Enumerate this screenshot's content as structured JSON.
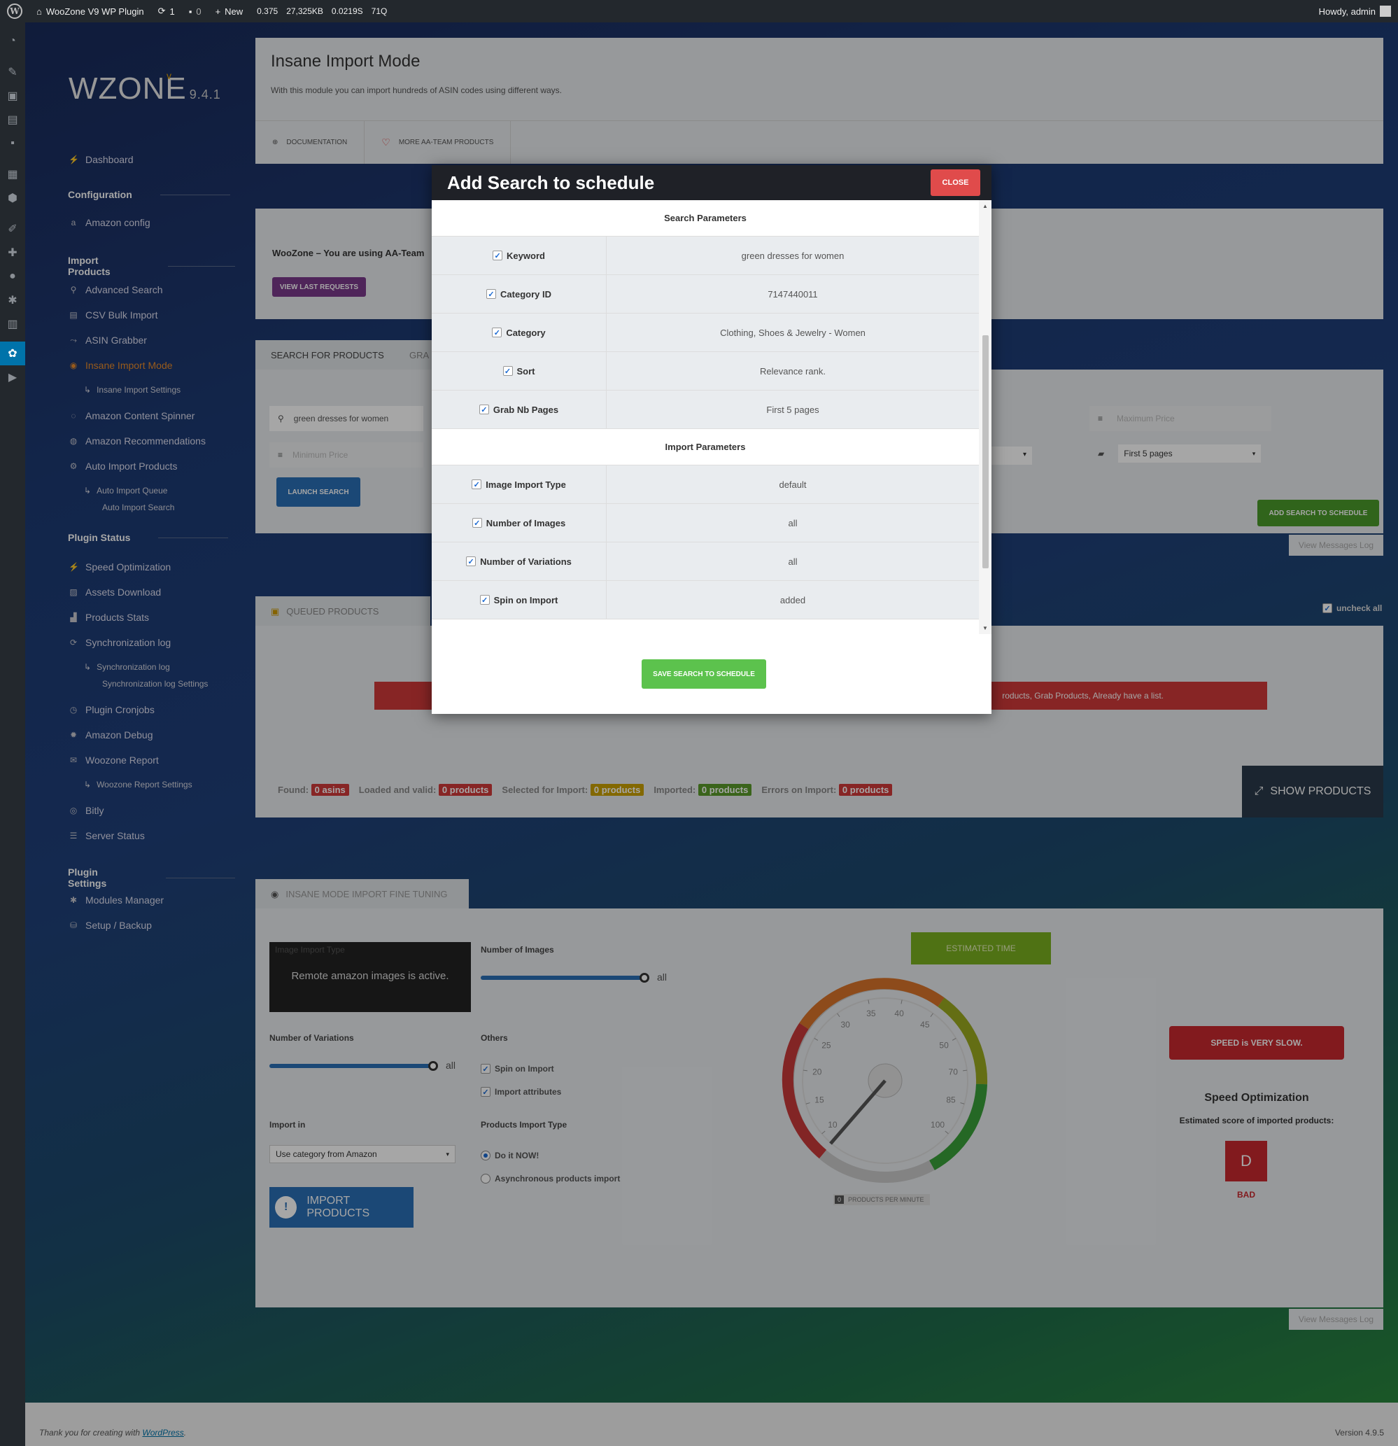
{
  "adminbar": {
    "site_name": "WooZone V9 WP Plugin",
    "updates": "1",
    "comments": "0",
    "new_label": "New",
    "stats": [
      "0.375",
      "27,325KB",
      "0.0219S",
      "71Q"
    ],
    "howdy": "Howdy, admin"
  },
  "logo": {
    "text": "WZONE",
    "version_prefix": "v",
    "version": "9.4.1"
  },
  "sidebar": {
    "dashboard": "Dashboard",
    "configuration": "Configuration",
    "amazon_config": "Amazon config",
    "import_products": "Import Products",
    "advanced_search": "Advanced Search",
    "csv_bulk_import": "CSV Bulk Import",
    "asin_grabber": "ASIN Grabber",
    "insane_import_mode": "Insane Import Mode",
    "insane_import_settings": "Insane Import Settings",
    "amazon_content_spinner": "Amazon Content Spinner",
    "amazon_recommendations": "Amazon Recommendations",
    "auto_import_products": "Auto Import Products",
    "auto_import_queue": "Auto Import Queue",
    "auto_import_search": "Auto Import Search",
    "plugin_status": "Plugin Status",
    "speed_optimization": "Speed Optimization",
    "assets_download": "Assets Download",
    "products_stats": "Products Stats",
    "synchronization_log": "Synchronization log",
    "synchronization_log_sub": "Synchronization log",
    "synchronization_log_settings": "Synchronization log Settings",
    "plugin_cronjobs": "Plugin Cronjobs",
    "amazon_debug": "Amazon Debug",
    "woozone_report": "Woozone Report",
    "woozone_report_settings": "Woozone Report Settings",
    "bitly": "Bitly",
    "server_status": "Server Status",
    "plugin_settings": "Plugin Settings",
    "modules_manager": "Modules Manager",
    "setup_backup": "Setup / Backup"
  },
  "header": {
    "title": "Insane Import Mode",
    "description": "With this module you can import hundreds of ASIN codes using different ways.",
    "documentation": "DOCUMENTATION",
    "more_products": "MORE AA-TEAM PRODUCTS"
  },
  "notice": {
    "text": "WooZone – You are using AA-Team",
    "button": "VIEW LAST REQUESTS"
  },
  "search_panel": {
    "tab_search": "SEARCH FOR PRODUCTS",
    "tab_grab": "GRA",
    "keyword_value": "green dresses for women",
    "min_price_placeholder": "Minimum Price",
    "max_price_placeholder": "Maximum Price",
    "grab_pages_value": "First 5 pages",
    "launch": "LAUNCH SEARCH",
    "add_to_schedule": "ADD SEARCH TO SCHEDULE",
    "view_messages_log": "View Messages Log"
  },
  "queue_panel": {
    "tab_queued": "QUEUED PRODUCTS",
    "uncheck_all": "uncheck all",
    "alert": "roducts, Grab Products, Already have a list.",
    "found_label": "Found:",
    "found_value": "0",
    "found_unit": "asins",
    "loaded_label": "Loaded and valid:",
    "loaded_value": "0",
    "loaded_unit": "products",
    "selected_label": "Selected for Import:",
    "selected_value": "0",
    "selected_unit": "products",
    "imported_label": "Imported:",
    "imported_value": "0",
    "imported_unit": "products",
    "errors_label": "Errors on Import:",
    "errors_value": "0",
    "errors_unit": "products",
    "show_products": "SHOW PRODUCTS"
  },
  "fine_tuning": {
    "tab": "INSANE MODE IMPORT FINE TUNING",
    "image_import_type": "Image Import Type",
    "remote_notice": "Remote amazon images is active.",
    "number_of_images": "Number of Images",
    "images_value": "all",
    "number_of_variations": "Number of Variations",
    "variations_value": "all",
    "others": "Others",
    "spin_on_import": "Spin on Import",
    "import_attributes": "Import attributes",
    "import_in": "Import in",
    "import_in_value": "Use category from Amazon",
    "products_import_type": "Products Import Type",
    "do_it_now": "Do it NOW!",
    "async": "Asynchronous products import",
    "import_button": "IMPORT PRODUCTS",
    "estimated_time": "ESTIMATED TIME",
    "gauge_ticks": [
      "10",
      "15",
      "20",
      "25",
      "30",
      "35",
      "40",
      "45",
      "50",
      "70",
      "85",
      "100"
    ],
    "gauge_readout": "0",
    "products_per_minute": "PRODUCTS PER MINUTE",
    "speed_status": "SPEED is VERY SLOW.",
    "speed_title": "Speed Optimization",
    "estimated_score_label": "Estimated score of imported products:",
    "grade": "D",
    "grade_label": "BAD",
    "view_messages_log": "View Messages Log"
  },
  "modal": {
    "title": "Add Search to schedule",
    "close": "CLOSE",
    "search_params_heading": "Search Parameters",
    "search_params": [
      {
        "label": "Keyword",
        "value": "green dresses for women"
      },
      {
        "label": "Category ID",
        "value": "7147440011"
      },
      {
        "label": "Category",
        "value": "Clothing, Shoes & Jewelry - Women"
      },
      {
        "label": "Sort",
        "value": "Relevance rank."
      },
      {
        "label": "Grab Nb Pages",
        "value": "First 5 pages"
      }
    ],
    "import_params_heading": "Import Parameters",
    "import_params": [
      {
        "label": "Image Import Type",
        "value": "default"
      },
      {
        "label": "Number of Images",
        "value": "all"
      },
      {
        "label": "Number of Variations",
        "value": "all"
      },
      {
        "label": "Spin on Import",
        "value": "added"
      }
    ],
    "save": "SAVE SEARCH TO SCHEDULE"
  },
  "footer": {
    "thanks": "Thank you for creating with",
    "wordpress": "WordPress",
    "version": "Version 4.9.5"
  },
  "colors": {
    "accent_blue": "#2a6fb5",
    "green": "#5cc24d",
    "red": "#e04b4b",
    "orange": "#e88a2a"
  }
}
